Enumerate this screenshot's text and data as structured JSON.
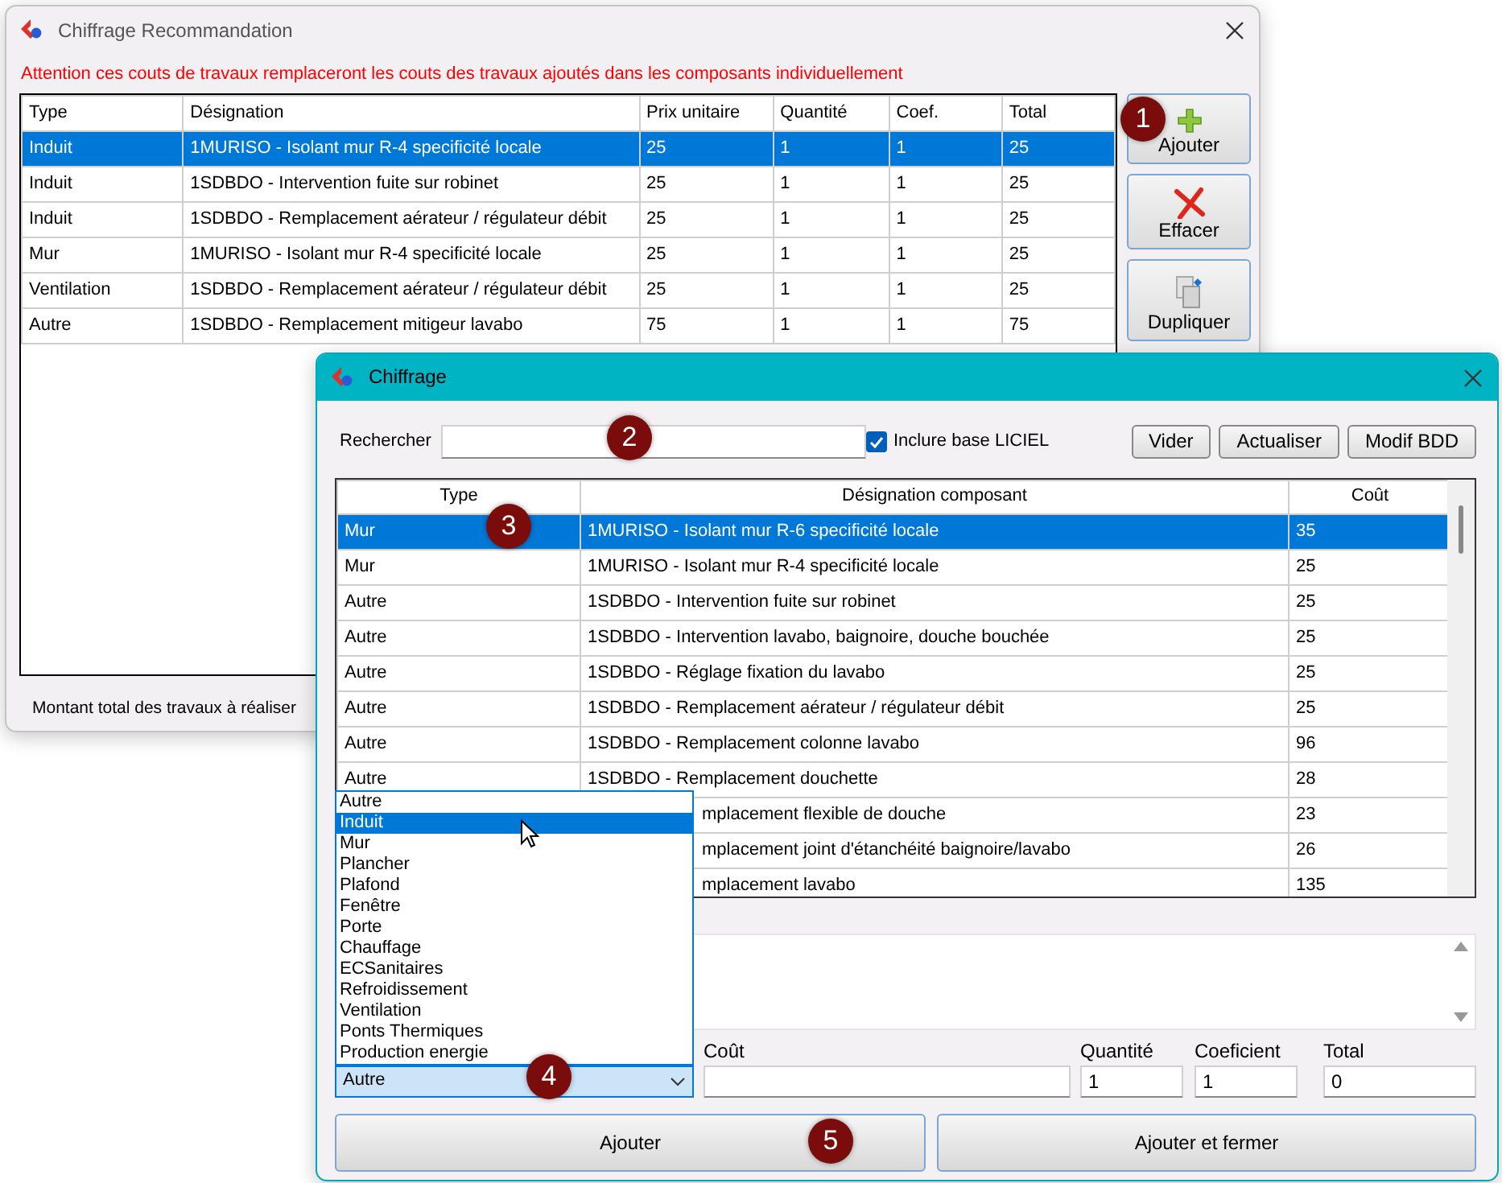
{
  "back_window": {
    "title": "Chiffrage Recommandation",
    "warning": "Attention ces couts de travaux remplaceront les couts des travaux ajoutés dans les composants individuellement",
    "table": {
      "columns": [
        "Type",
        "Désignation",
        "Prix unitaire",
        "Quantité",
        "Coef.",
        "Total"
      ],
      "rows": [
        {
          "cells": [
            "Induit",
            "1MURISO - Isolant mur R-4 specificité locale",
            "25",
            "1",
            "1",
            "25"
          ],
          "selected": true
        },
        {
          "cells": [
            "Induit",
            "1SDBDO - Intervention fuite sur robinet",
            "25",
            "1",
            "1",
            "25"
          ],
          "selected": false
        },
        {
          "cells": [
            "Induit",
            "1SDBDO - Remplacement aérateur / régulateur débit",
            "25",
            "1",
            "1",
            "25"
          ],
          "selected": false
        },
        {
          "cells": [
            "Mur",
            "1MURISO - Isolant mur R-4 specificité locale",
            "25",
            "1",
            "1",
            "25"
          ],
          "selected": false
        },
        {
          "cells": [
            "Ventilation",
            "1SDBDO - Remplacement aérateur / régulateur débit",
            "25",
            "1",
            "1",
            "25"
          ],
          "selected": false
        },
        {
          "cells": [
            "Autre",
            "1SDBDO - Remplacement mitigeur lavabo",
            "75",
            "1",
            "1",
            "75"
          ],
          "selected": false
        }
      ]
    },
    "buttons": [
      {
        "label": "Ajouter",
        "kind": "plus"
      },
      {
        "label": "Effacer",
        "kind": "cross"
      },
      {
        "label": "Dupliquer",
        "kind": "copy"
      }
    ],
    "total_label": "Montant total des travaux à réaliser"
  },
  "front_window": {
    "title": "Chiffrage",
    "search_label": "Rechercher",
    "include_checkbox": {
      "label": "Inclure base LICIEL",
      "checked": true
    },
    "toolbar_buttons": [
      "Vider",
      "Actualiser",
      "Modif BDD"
    ],
    "grid": {
      "columns": [
        "Type",
        "Désignation composant",
        "Coût"
      ],
      "rows": [
        {
          "kind": "full",
          "type": "Mur",
          "designation": "1MURISO - Isolant mur R-6 specificité locale",
          "cost": "35",
          "selected": true
        },
        {
          "kind": "full",
          "type": "Mur",
          "designation": "1MURISO - Isolant mur R-4 specificité locale",
          "cost": "25",
          "selected": false
        },
        {
          "kind": "full",
          "type": "Autre",
          "designation": "1SDBDO - Intervention fuite sur robinet",
          "cost": "25",
          "selected": false
        },
        {
          "kind": "full",
          "type": "Autre",
          "designation": "1SDBDO - Intervention lavabo, baignoire, douche bouchée",
          "cost": "25",
          "selected": false
        },
        {
          "kind": "full",
          "type": "Autre",
          "designation": "1SDBDO - Réglage fixation du lavabo",
          "cost": "25",
          "selected": false
        },
        {
          "kind": "full",
          "type": "Autre",
          "designation": "1SDBDO - Remplacement aérateur / régulateur débit",
          "cost": "25",
          "selected": false
        },
        {
          "kind": "full",
          "type": "Autre",
          "designation": "1SDBDO - Remplacement colonne lavabo",
          "cost": "96",
          "selected": false
        },
        {
          "kind": "full",
          "type": "Autre",
          "designation": "1SDBDO - Remplacement douchette",
          "cost": "28",
          "selected": false
        },
        {
          "kind": "covered",
          "designation": "mplacement flexible de douche",
          "cost": "23",
          "selected": false
        },
        {
          "kind": "covered",
          "designation": "mplacement joint d'étanchéité baignoire/lavabo",
          "cost": "26",
          "selected": false
        },
        {
          "kind": "covered",
          "designation": "mplacement lavabo",
          "cost": "135",
          "selected": false
        }
      ]
    },
    "type_combo": {
      "value": "Autre",
      "expanded": true,
      "options": [
        {
          "label": "Autre",
          "highlighted": false
        },
        {
          "label": "Induit",
          "highlighted": true
        },
        {
          "label": "Mur",
          "highlighted": false
        },
        {
          "label": "Plancher",
          "highlighted": false
        },
        {
          "label": "Plafond",
          "highlighted": false
        },
        {
          "label": "Fenêtre",
          "highlighted": false
        },
        {
          "label": "Porte",
          "highlighted": false
        },
        {
          "label": "Chauffage",
          "highlighted": false
        },
        {
          "label": "ECSanitaires",
          "highlighted": false
        },
        {
          "label": "Refroidissement",
          "highlighted": false
        },
        {
          "label": "Ventilation",
          "highlighted": false
        },
        {
          "label": "Ponts Thermiques",
          "highlighted": false
        },
        {
          "label": "Production energie",
          "highlighted": false
        }
      ]
    },
    "fields": [
      {
        "label": "Coût"
      },
      {
        "label": "Quantité",
        "value": "1"
      },
      {
        "label": "Coeficient",
        "value": "1"
      },
      {
        "label": "Total",
        "value": "0"
      }
    ],
    "buttons": [
      "Ajouter",
      "Ajouter et fermer"
    ]
  },
  "markers": [
    "1",
    "2",
    "3",
    "4",
    "5"
  ]
}
